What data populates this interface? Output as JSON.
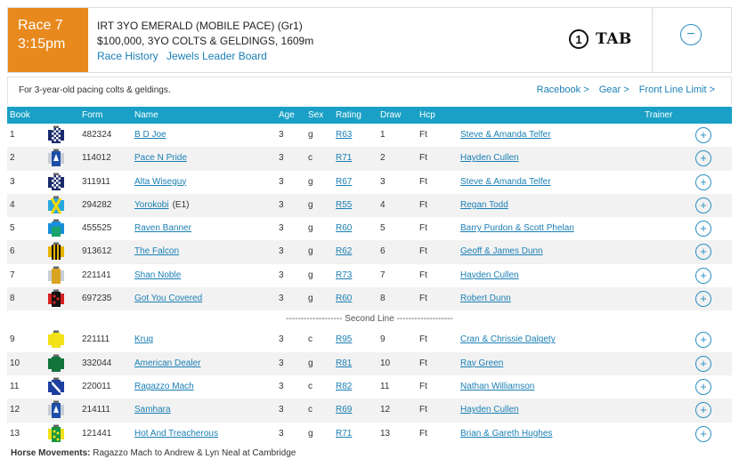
{
  "race": {
    "number": "Race 7",
    "time": "3:15pm",
    "title": "IRT 3YO EMERALD (MOBILE PACE) (Gr1)",
    "subtitle": "$100,000, 3YO COLTS & GELDINGS, 1609m",
    "links": [
      "Race History",
      "Jewels Leader Board"
    ],
    "brand_number": "1",
    "brand_text": "TAB",
    "collapse_symbol": "−"
  },
  "conditions": "For 3-year-old pacing colts & geldings.",
  "cond_links": [
    "Racebook >",
    "Gear >",
    "Front Line Limit >"
  ],
  "columns": {
    "book": "Book",
    "form": "Form",
    "name": "Name",
    "age": "Age",
    "sex": "Sex",
    "rating": "Rating",
    "draw": "Draw",
    "hcp": "Hcp",
    "trainer": "Trainer"
  },
  "separator": "------------------- Second Line -------------------",
  "runners": [
    {
      "book": "1",
      "form": "482324",
      "name": "B D Joe",
      "age": "3",
      "sex": "g",
      "rating": "R63",
      "draw": "1",
      "hcp": "Ft",
      "trainer": "Steve & Amanda Telfer",
      "silk": "navy-white-check",
      "add": "+"
    },
    {
      "book": "2",
      "form": "114012",
      "name": "Pace N Pride",
      "age": "3",
      "sex": "c",
      "rating": "R71",
      "draw": "2",
      "hcp": "Ft",
      "trainer": "Hayden Cullen",
      "silk": "royal-blue-white-sleeves",
      "add": "+"
    },
    {
      "book": "3",
      "form": "311911",
      "name": "Alta Wiseguy",
      "age": "3",
      "sex": "g",
      "rating": "R67",
      "draw": "3",
      "hcp": "Ft",
      "trainer": "Steve & Amanda Telfer",
      "silk": "navy-white-check",
      "add": "+"
    },
    {
      "book": "4",
      "form": "294282",
      "name": "Yorokobi",
      "name_suffix": "(E1)",
      "age": "3",
      "sex": "g",
      "rating": "R55",
      "draw": "4",
      "hcp": "Ft",
      "trainer": "Regan Todd",
      "silk": "sky-blue-yellow-cross",
      "add": "+"
    },
    {
      "book": "5",
      "form": "455525",
      "name": "Raven Banner",
      "age": "3",
      "sex": "g",
      "rating": "R60",
      "draw": "5",
      "hcp": "Ft",
      "trainer": "Barry Purdon & Scott Phelan",
      "silk": "green-blue",
      "add": "+"
    },
    {
      "book": "6",
      "form": "913612",
      "name": "The Falcon",
      "age": "3",
      "sex": "g",
      "rating": "R62",
      "draw": "6",
      "hcp": "Ft",
      "trainer": "Geoff & James Dunn",
      "silk": "black-gold-stripes",
      "add": "+"
    },
    {
      "book": "7",
      "form": "221141",
      "name": "Shan Noble",
      "age": "3",
      "sex": "g",
      "rating": "R73",
      "draw": "7",
      "hcp": "Ft",
      "trainer": "Hayden Cullen",
      "silk": "gold-plain",
      "add": "+"
    },
    {
      "book": "8",
      "form": "697235",
      "name": "Got You Covered",
      "age": "3",
      "sex": "g",
      "rating": "R60",
      "draw": "8",
      "hcp": "Ft",
      "trainer": "Robert Dunn",
      "silk": "red-black-spots",
      "add": "+"
    },
    {
      "book": "9",
      "form": "221111",
      "name": "Krug",
      "age": "3",
      "sex": "c",
      "rating": "R95",
      "draw": "9",
      "hcp": "Ft",
      "trainer": "Cran & Chrissie Dalgety",
      "silk": "yellow-plain",
      "add": "+"
    },
    {
      "book": "10",
      "form": "332044",
      "name": "American Dealer",
      "age": "3",
      "sex": "g",
      "rating": "R81",
      "draw": "10",
      "hcp": "Ft",
      "trainer": "Ray Green",
      "silk": "dark-green",
      "add": "+"
    },
    {
      "book": "11",
      "form": "220011",
      "name": "Ragazzo Mach",
      "age": "3",
      "sex": "c",
      "rating": "R82",
      "draw": "11",
      "hcp": "Ft",
      "trainer": "Nathan Williamson",
      "silk": "blue-white-sash",
      "add": "+"
    },
    {
      "book": "12",
      "form": "214111",
      "name": "Samhara",
      "age": "3",
      "sex": "c",
      "rating": "R69",
      "draw": "12",
      "hcp": "Ft",
      "trainer": "Hayden Cullen",
      "silk": "royal-blue-white-sleeves",
      "add": "+"
    },
    {
      "book": "13",
      "form": "121441",
      "name": "Hot And Treacherous",
      "age": "3",
      "sex": "g",
      "rating": "R71",
      "draw": "13",
      "hcp": "Ft",
      "trainer": "Brian & Gareth Hughes",
      "silk": "green-yellow-spots",
      "add": "+"
    }
  ],
  "movements": {
    "label": "Horse Movements:",
    "text": "Ragazzo Mach to Andrew & Lyn Neal at Cambridge"
  },
  "colors": {
    "accent": "#1aa0c6",
    "badge": "#e8891d",
    "link": "#1a7fb5"
  }
}
